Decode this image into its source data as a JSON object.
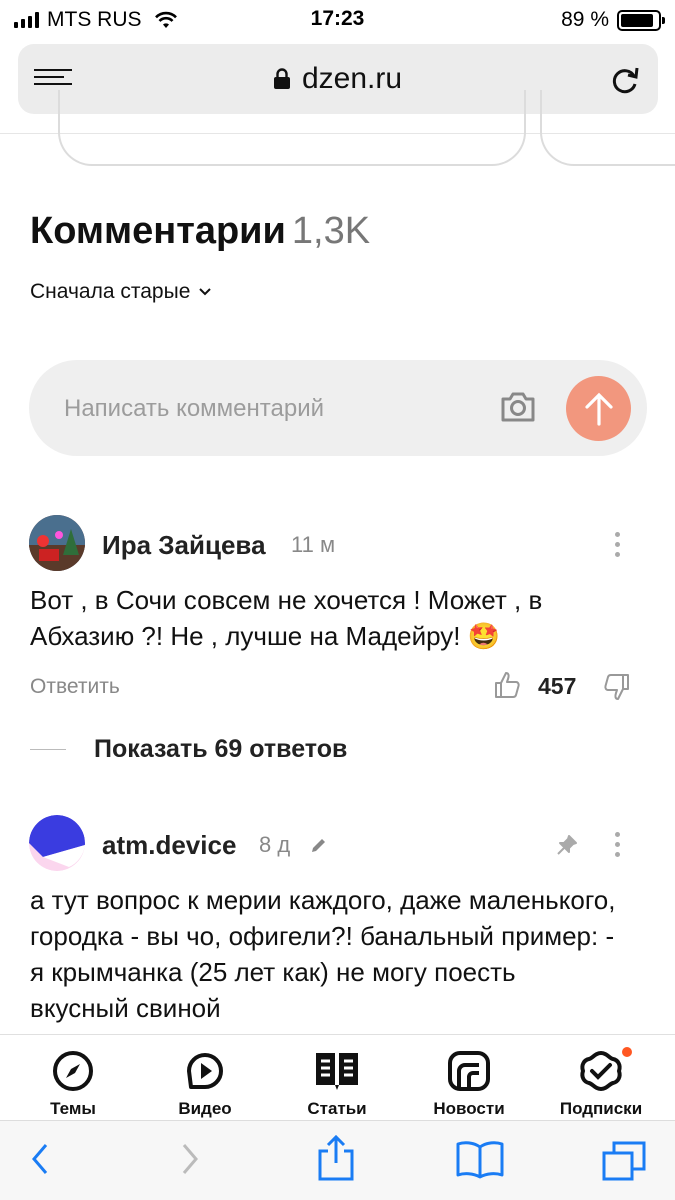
{
  "status_bar": {
    "carrier": "MTS RUS",
    "time": "17:23",
    "battery": "89 %"
  },
  "browser": {
    "url": "dzen.ru"
  },
  "comments": {
    "title": "Комментарии",
    "count": "1,3K",
    "sort_label": "Сначала старые",
    "input_placeholder": "Написать комментарий"
  },
  "comment_list": [
    {
      "author": "Ира Зайцева",
      "time": "11 м",
      "text": "Вот , в Сочи совсем не хочется ! Может , в Абхазию ?! Не , лучше на Мадейру! 🤩",
      "reply_label": "Ответить",
      "likes": "457",
      "show_replies": "Показать 69 ответов"
    },
    {
      "author": "atm.device",
      "time": "8 д",
      "text": "а тут вопрос к мерии каждого, даже маленького, городка - вы чо, офигели?! банальный пример: - я крымчанка (25 лет как) не могу поесть вкусный свиной"
    }
  ],
  "bottom_nav": [
    {
      "label": "Темы",
      "icon": "compass-icon"
    },
    {
      "label": "Видео",
      "icon": "video-icon"
    },
    {
      "label": "Статьи",
      "icon": "articles-icon"
    },
    {
      "label": "Новости",
      "icon": "news-icon"
    },
    {
      "label": "Подписки",
      "icon": "subscriptions-icon"
    }
  ],
  "colors": {
    "accent": "#f2977e",
    "notification_dot": "#ff5722",
    "safari_blue": "#1a7cf4"
  }
}
